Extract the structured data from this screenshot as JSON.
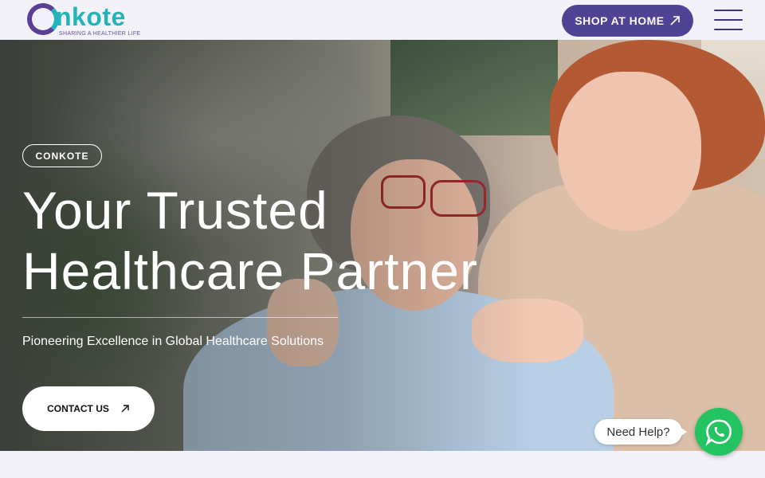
{
  "brand": {
    "name": "CONKOTE",
    "logo_word": "nkote",
    "tagline": "SHARING A HEALTHIER LIFE"
  },
  "header": {
    "shop_label": "SHOP AT HOME"
  },
  "hero": {
    "badge": "CONKOTE",
    "headline_line1": "Your Trusted",
    "headline_line2": "Healthcare Partner",
    "subtitle": "Pioneering Excellence in Global Healthcare Solutions",
    "contact_label": "CONTACT US"
  },
  "help": {
    "label": "Need Help?"
  },
  "icons": {
    "arrow": "arrow-up-right-icon",
    "menu": "hamburger-menu-icon",
    "whatsapp": "whatsapp-icon"
  },
  "colors": {
    "accent": "#4f4394",
    "logo_teal": "#23b4b9",
    "logo_purple": "#5b3f97",
    "whatsapp_green": "#23c461"
  }
}
